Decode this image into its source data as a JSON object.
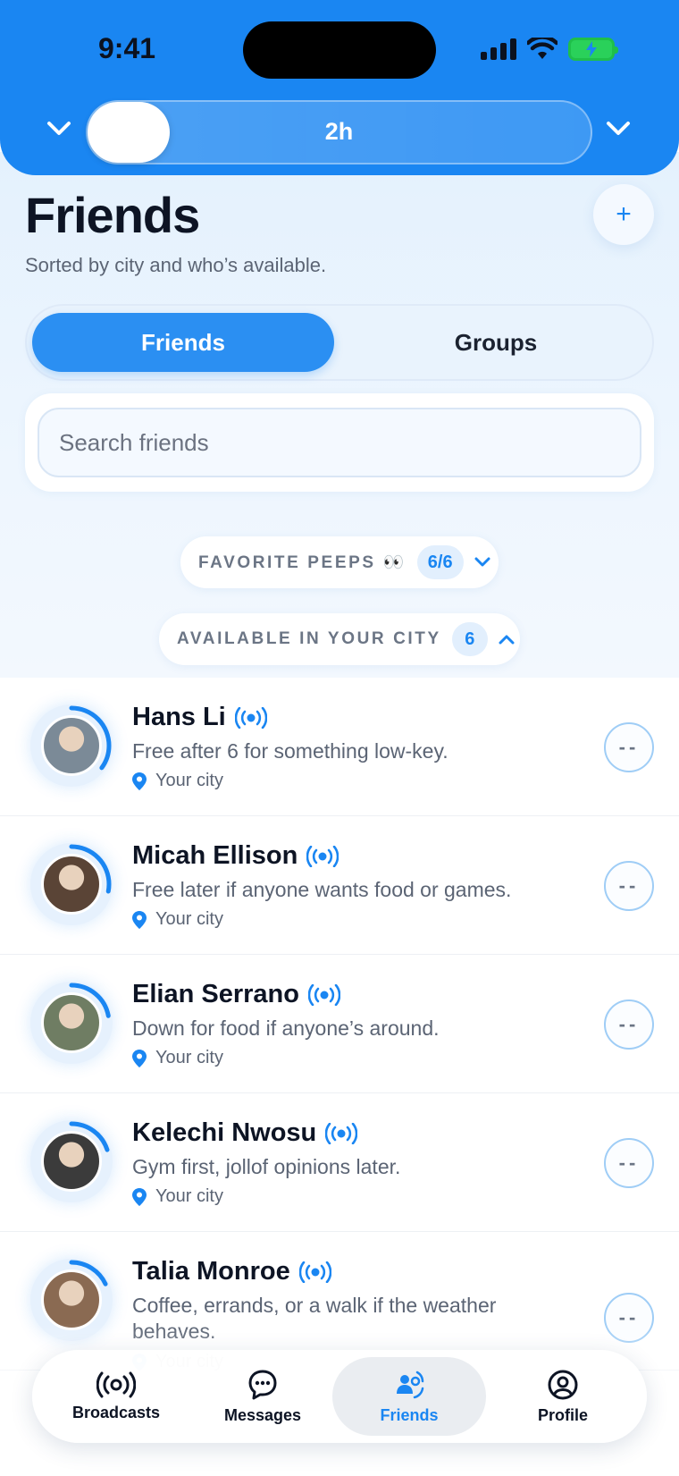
{
  "status_bar": {
    "time": "9:41"
  },
  "header": {
    "duration_label": "2h",
    "duration_slider_value": 0.0
  },
  "page": {
    "title": "Friends",
    "subtitle": "Sorted by city and who’s available.",
    "add_label": "+"
  },
  "segments": {
    "active": "Friends",
    "other": "Groups"
  },
  "search": {
    "placeholder": "Search friends",
    "value": ""
  },
  "sections": {
    "favorites": {
      "label": "FAVORITE PEEPS 👀",
      "count": "6/6",
      "expanded": false
    },
    "available": {
      "label": "AVAILABLE IN YOUR CITY",
      "count": "6",
      "expanded": true
    }
  },
  "friends": [
    {
      "name": "Hans Li",
      "status": "Free after 6 for something low-key.",
      "location": "Your city",
      "availability": 0.35,
      "avatar_color": "#7b8a97",
      "action": "--"
    },
    {
      "name": "Micah Ellison",
      "status": "Free later if anyone wants food or games.",
      "location": "Your city",
      "availability": 0.28,
      "avatar_color": "#5a4436",
      "action": "--"
    },
    {
      "name": "Elian Serrano",
      "status": "Down for food if anyone’s around.",
      "location": "Your city",
      "availability": 0.22,
      "avatar_color": "#6f7d63",
      "action": "--"
    },
    {
      "name": "Kelechi Nwosu",
      "status": "Gym first, jollof opinions later.",
      "location": "Your city",
      "availability": 0.2,
      "avatar_color": "#3b3b3b",
      "action": "--"
    },
    {
      "name": "Talia Monroe",
      "status": "Coffee, errands, or a walk if the weather behaves.",
      "location": "Your city",
      "availability": 0.18,
      "avatar_color": "#8a6a52",
      "action": "--"
    }
  ],
  "tabs": [
    {
      "label": "Broadcasts",
      "icon": "broadcast-icon",
      "active": false
    },
    {
      "label": "Messages",
      "icon": "messages-icon",
      "active": false
    },
    {
      "label": "Friends",
      "icon": "friends-icon",
      "active": true
    },
    {
      "label": "Profile",
      "icon": "profile-icon",
      "active": false
    }
  ],
  "colors": {
    "accent": "#1a86f2",
    "header_bg": "#1a86f2",
    "page_bg": "#e4f1fd",
    "battery": "#2ad15a"
  }
}
